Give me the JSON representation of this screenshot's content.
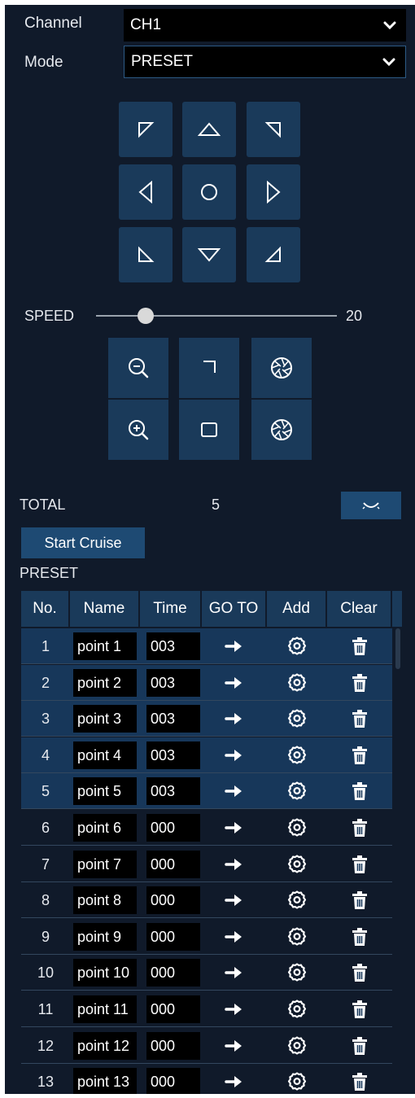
{
  "colors": {
    "panel_bg": "#101a2a",
    "button_bg": "#1a3a5a",
    "selected_row_bg": "#17375a",
    "field_bg": "#000000"
  },
  "channel": {
    "label": "Channel",
    "value": "CH1"
  },
  "mode": {
    "label": "Mode",
    "value": "PRESET"
  },
  "ptz": {
    "directions": [
      "up-left-icon",
      "up-icon",
      "up-right-icon",
      "left-icon",
      "auto-icon",
      "right-icon",
      "down-left-icon",
      "down-icon",
      "down-right-icon"
    ]
  },
  "speed": {
    "label": "SPEED",
    "value": "20",
    "level_fraction": 0.14
  },
  "controls": {
    "zoom_out": "zoom-out-icon",
    "focus_near": "focus-icon",
    "iris_close": "iris-icon",
    "zoom_in": "zoom-in-icon",
    "focus_far": "focus-square-icon",
    "iris_open": "iris-open-icon"
  },
  "total": {
    "label": "TOTAL",
    "value": "5"
  },
  "start_cruise": {
    "label": "Start Cruise"
  },
  "preset": {
    "title": "PRESET",
    "headers": {
      "no": "No.",
      "name": "Name",
      "time": "Time",
      "goto": "GO TO",
      "add": "Add",
      "clear": "Clear"
    },
    "rows": [
      {
        "no": "1",
        "name": "point 1",
        "time": "003",
        "selected": true
      },
      {
        "no": "2",
        "name": "point 2",
        "time": "003",
        "selected": true
      },
      {
        "no": "3",
        "name": "point 3",
        "time": "003",
        "selected": true
      },
      {
        "no": "4",
        "name": "point 4",
        "time": "003",
        "selected": true
      },
      {
        "no": "5",
        "name": "point 5",
        "time": "003",
        "selected": true
      },
      {
        "no": "6",
        "name": "point 6",
        "time": "000",
        "selected": false
      },
      {
        "no": "7",
        "name": "point 7",
        "time": "000",
        "selected": false
      },
      {
        "no": "8",
        "name": "point 8",
        "time": "000",
        "selected": false
      },
      {
        "no": "9",
        "name": "point 9",
        "time": "000",
        "selected": false
      },
      {
        "no": "10",
        "name": "point 10",
        "time": "000",
        "selected": false
      },
      {
        "no": "11",
        "name": "point 11",
        "time": "000",
        "selected": false
      },
      {
        "no": "12",
        "name": "point 12",
        "time": "000",
        "selected": false
      },
      {
        "no": "13",
        "name": "point 13",
        "time": "000",
        "selected": false
      }
    ]
  }
}
